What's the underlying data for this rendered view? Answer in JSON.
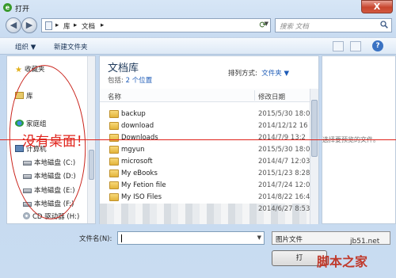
{
  "window": {
    "title": "打开",
    "close_glyph": "X"
  },
  "address": {
    "crumbs": [
      "库",
      "文档"
    ],
    "separator": "▸",
    "search_placeholder": "搜索 文档"
  },
  "toolbar": {
    "organize": "组织 ▼",
    "new_folder": "新建文件夹"
  },
  "nav_pane": {
    "items": [
      {
        "label": "收藏夹",
        "icon": "star-icon"
      },
      {
        "label": "库",
        "icon": "library-icon"
      },
      {
        "label": "家庭组",
        "icon": "homegroup-icon"
      },
      {
        "label": "计算机",
        "icon": "computer-icon"
      },
      {
        "label": "本地磁盘 (C:)",
        "icon": "drive-icon"
      },
      {
        "label": "本地磁盘 (D:)",
        "icon": "drive-icon"
      },
      {
        "label": "本地磁盘 (E:)",
        "icon": "drive-icon"
      },
      {
        "label": "本地磁盘 (F:)",
        "icon": "drive-icon"
      },
      {
        "label": "CD 驱动器 (H:)",
        "icon": "cd-drive-icon"
      }
    ]
  },
  "library": {
    "title": "文档库",
    "includes_label": "包括: ",
    "includes_link": "2 个位置",
    "arrange_label": "排列方式:",
    "arrange_value": "文件夹 ▼",
    "col_name": "名称",
    "col_date": "修改日期",
    "files": [
      {
        "name": "backup",
        "date": "2015/5/30 18:0"
      },
      {
        "name": "download",
        "date": "2014/12/12 16"
      },
      {
        "name": "Downloads",
        "date": "2014/7/9 13:2"
      },
      {
        "name": "mgyun",
        "date": "2015/5/30 18:0"
      },
      {
        "name": "microsoft",
        "date": "2014/4/7 12:03"
      },
      {
        "name": "My eBooks",
        "date": "2015/1/23 8:28"
      },
      {
        "name": "My Fetion file",
        "date": "2014/7/24 12:0"
      },
      {
        "name": "My ISO Files",
        "date": "2014/8/22 16:4"
      },
      {
        "name": "",
        "date": "2014/6/27 8:53"
      }
    ]
  },
  "preview": {
    "text": "选择要预览的文件。"
  },
  "footer": {
    "filename_label": "文件名(N):",
    "filetype": "图片文件",
    "open_button": "打"
  },
  "annotation": {
    "text": "没有桌面！",
    "color": "#e0231b"
  },
  "watermark": {
    "site": "jb51.net",
    "name": "脚本之家"
  }
}
